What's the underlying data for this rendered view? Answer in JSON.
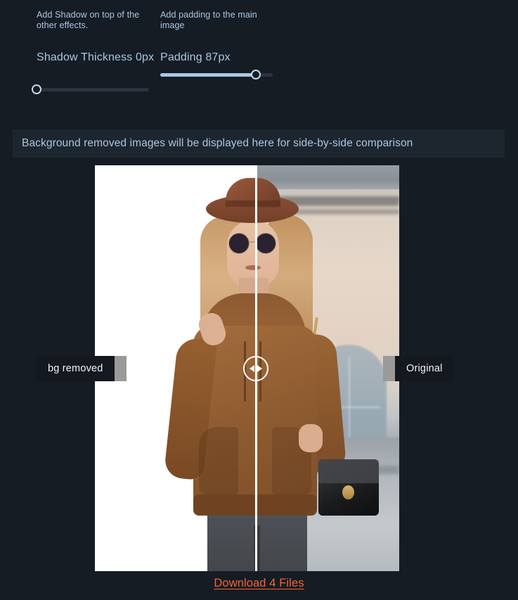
{
  "theme": {
    "page_background": "#151c24",
    "banner_background": "#1d262e",
    "muted_text": "#a9c6e4",
    "accent_link": "#f4652b",
    "slider_fill": "#a9c6e4",
    "slider_track": "#2b3440",
    "tag_background": "#14181f"
  },
  "controls": {
    "shadow": {
      "description": "Add Shadow on top of the other effects.",
      "title": "Shadow Thickness 0px",
      "label": "Shadow Thickness",
      "value_text": "0px",
      "value": 0,
      "min": 0,
      "max": 100,
      "percent": 0
    },
    "padding": {
      "description": "Add padding to the main image",
      "title": "Padding 87px",
      "label": "Padding",
      "value_text": "87px",
      "value": 87,
      "min": 0,
      "max": 100,
      "percent": 85
    }
  },
  "banner": {
    "text": "Background removed images will be displayed here for side-by-side comparison"
  },
  "comparison": {
    "left_tag": "bg removed",
    "right_tag": "Original",
    "handle_icon": "left-right-arrows-icon",
    "divider_position_percent": 53,
    "image_subject": "Woman in brown hoodie, hat and sunglasses with black quilted handbag on a city street"
  },
  "footer": {
    "download_label": "Download 4 Files",
    "file_count": 4
  }
}
